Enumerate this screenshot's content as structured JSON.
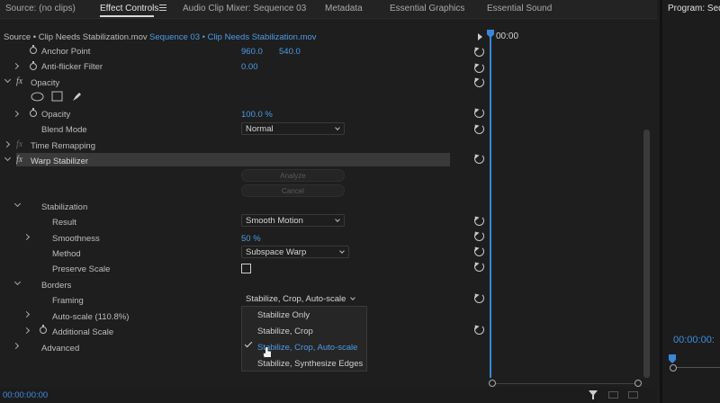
{
  "tabs": [
    {
      "label": "Source: (no clips)"
    },
    {
      "label": "Effect Controls"
    },
    {
      "label": "Audio Clip Mixer: Sequence 03"
    },
    {
      "label": "Metadata"
    },
    {
      "label": "Essential Graphics"
    },
    {
      "label": "Essential Sound"
    }
  ],
  "program": {
    "title": "Program: Sequ",
    "timecode": "00:00:00:"
  },
  "source_bar": {
    "source": "Source • Clip Needs Stabilization.mov",
    "sequence": "Sequence 03 • Clip Needs Stabilization.mov"
  },
  "timeline": {
    "time": "00:00"
  },
  "properties": {
    "anchor_point": {
      "label": "Anchor Point",
      "x": "960.0",
      "y": "540.0"
    },
    "anti_flicker": {
      "label": "Anti-flicker Filter",
      "value": "0.00"
    },
    "opacity_section": {
      "label": "Opacity"
    },
    "opacity": {
      "label": "Opacity",
      "value": "100.0 %"
    },
    "blend_mode": {
      "label": "Blend Mode",
      "value": "Normal"
    },
    "time_remapping": {
      "label": "Time Remapping"
    },
    "warp_stabilizer": {
      "label": "Warp Stabilizer"
    },
    "analyze": "Analyze",
    "cancel": "Cancel",
    "stabilization": {
      "label": "Stabilization"
    },
    "result": {
      "label": "Result",
      "value": "Smooth Motion"
    },
    "smoothness": {
      "label": "Smoothness",
      "value": "50 %"
    },
    "method": {
      "label": "Method",
      "value": "Subspace Warp"
    },
    "preserve_scale": {
      "label": "Preserve Scale"
    },
    "borders": {
      "label": "Borders"
    },
    "framing": {
      "label": "Framing",
      "value": "Stabilize, Crop, Auto-scale"
    },
    "auto_scale": {
      "label": "Auto-scale (110.8%)"
    },
    "additional_scale": {
      "label": "Additional Scale"
    },
    "advanced": {
      "label": "Advanced"
    }
  },
  "framing_menu": {
    "items": [
      "Stabilize Only",
      "Stabilize, Crop",
      "Stabilize, Crop, Auto-scale",
      "Stabilize, Synthesize Edges"
    ],
    "selected": "Stabilize, Crop, Auto-scale"
  },
  "footer": {
    "time": "00:00:00:00"
  },
  "colors": {
    "accent": "#4d9be6",
    "playhead": "#3b86d8",
    "background": "#1e1e1e"
  }
}
